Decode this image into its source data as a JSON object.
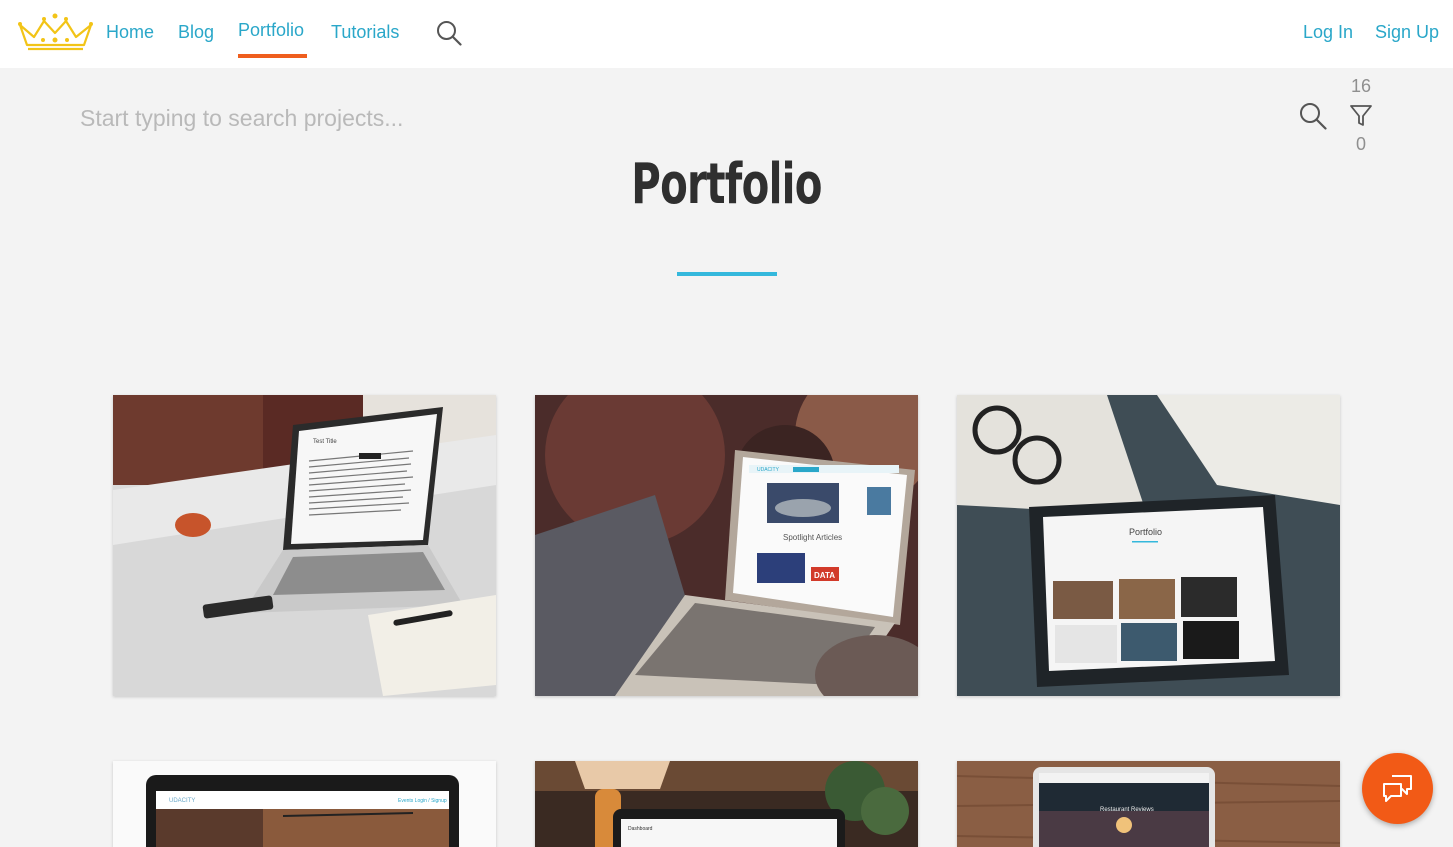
{
  "nav": {
    "home": "Home",
    "blog": "Blog",
    "portfolio": "Portfolio",
    "tutorials": "Tutorials",
    "login": "Log In",
    "signup": "Sign Up",
    "active": "Portfolio"
  },
  "search": {
    "placeholder": "Start typing to search projects..."
  },
  "filter": {
    "total_count": "16",
    "active_count": "0"
  },
  "page": {
    "title": "Portfolio"
  },
  "projects": [
    {
      "screen_title": "Test Title"
    },
    {
      "brand": "UDACITY",
      "heading": "Spotlight Articles",
      "badge": "DATA"
    },
    {
      "heading": "Portfolio"
    },
    {
      "brand": "UDACITY",
      "links": "Events   Login / Signup"
    },
    {
      "heading": "Dashboard"
    },
    {
      "heading": "Restaurant Reviews"
    }
  ],
  "colors": {
    "link": "#2aa7c9",
    "active_underline": "#ef5e1e",
    "title_underline": "#34b8dc",
    "chat_button": "#f25a16",
    "logo": "#f2c417"
  },
  "icons": {
    "logo": "crown-logo",
    "nav_search": "search-icon",
    "search": "search-icon",
    "filter": "filter-icon",
    "chat": "chat-icon"
  }
}
